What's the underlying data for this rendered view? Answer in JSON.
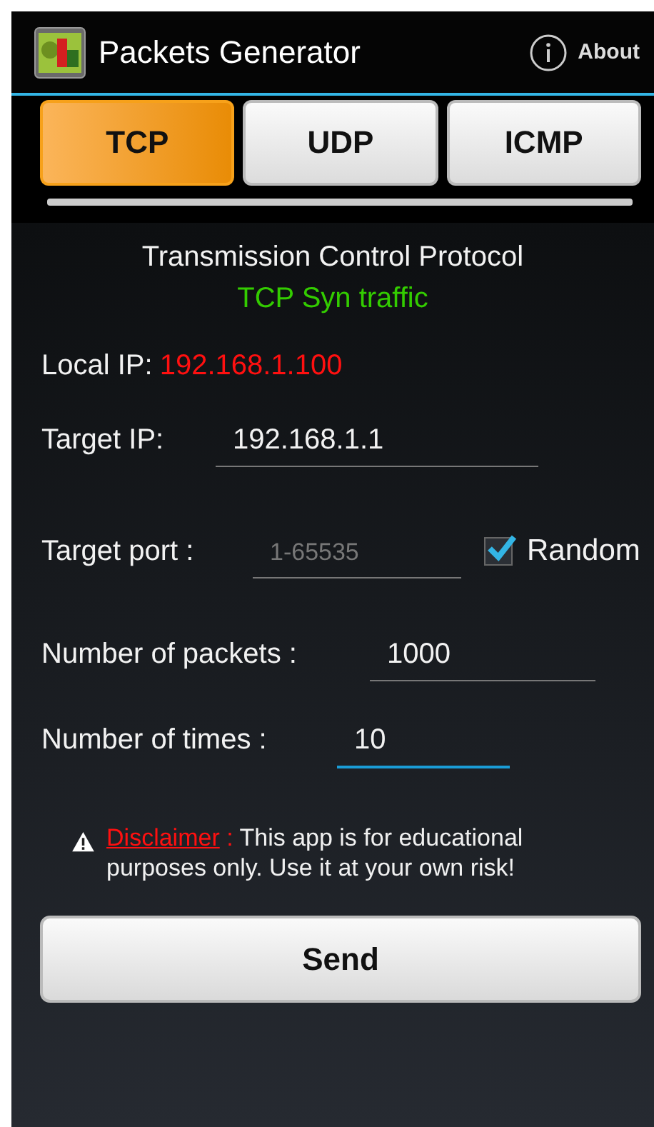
{
  "app_bar": {
    "title": "Packets Generator",
    "action": "About"
  },
  "tabs": [
    {
      "label": "TCP",
      "selected": true
    },
    {
      "label": "UDP",
      "selected": false
    },
    {
      "label": "ICMP",
      "selected": false
    }
  ],
  "heading": {
    "title": "Transmission Control Protocol",
    "subtitle": "TCP Syn traffic"
  },
  "local_ip": {
    "label": "Local IP:",
    "value": "192.168.1.100"
  },
  "fields": [
    {
      "label": "Target IP:",
      "value": "192.168.1.1",
      "focused": false
    },
    {
      "label": "Target port :",
      "placeholder": "1-65535",
      "focused": false,
      "checkbox": {
        "label": "Random",
        "checked": true
      }
    },
    {
      "label": "Number of packets :",
      "value": "1000",
      "focused": false
    },
    {
      "label": "Number of times :",
      "value": "10",
      "focused": true
    }
  ],
  "disclaimer": {
    "link": "Disclaimer",
    "separator": " :",
    "text": "This app is for educational purposes only. Use it at your own risk!"
  },
  "send_button": "Send"
}
